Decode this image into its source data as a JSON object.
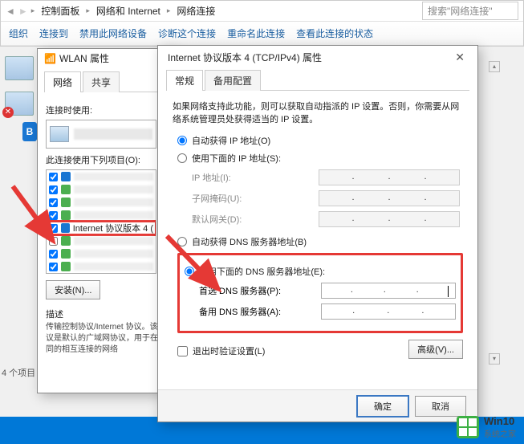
{
  "breadcrumb": {
    "seg1": "控制面板",
    "seg2": "网络和 Internet",
    "seg3": "网络连接",
    "search_placeholder": "搜索\"网络连接\""
  },
  "toolbar": {
    "org": "组织",
    "connect": "连接到",
    "disable": "禁用此网络设备",
    "diag": "诊断这个连接",
    "rename": "重命名此连接",
    "status": "查看此连接的状态"
  },
  "wlan": {
    "title": "WLAN 属性",
    "tab_network": "网络",
    "tab_share": "共享",
    "connect_using": "连接时使用:",
    "items_label": "此连接使用下列项目(O):",
    "ipv4_row": "Internet 协议版本 4 (",
    "install": "安装(N)...",
    "desc_h": "描述",
    "desc": "传输控制协议/Internet 协议。该协议是默认的广域网协议，用于在不同的相互连接的网络"
  },
  "ip": {
    "title": "Internet 协议版本 4 (TCP/IPv4) 属性",
    "tab_general": "常规",
    "tab_alt": "备用配置",
    "intro": "如果网络支持此功能，则可以获取自动指派的 IP 设置。否则，你需要从网络系统管理员处获得适当的 IP 设置。",
    "r_auto_ip": "自动获得 IP 地址(O)",
    "r_man_ip": "使用下面的 IP 地址(S):",
    "ip_addr": "IP 地址(I):",
    "mask": "子网掩码(U):",
    "gw": "默认网关(D):",
    "r_auto_dns": "自动获得 DNS 服务器地址(B)",
    "r_man_dns": "使用下面的 DNS 服务器地址(E):",
    "dns1": "首选 DNS 服务器(P):",
    "dns2": "备用 DNS 服务器(A):",
    "exit_val": "退出时验证设置(L)",
    "adv": "高级(V)...",
    "ok": "确定",
    "cancel": "取消"
  },
  "footer": {
    "count": "4 个项目"
  },
  "brand": {
    "t1": "Win10",
    "t2": "系统之家"
  }
}
